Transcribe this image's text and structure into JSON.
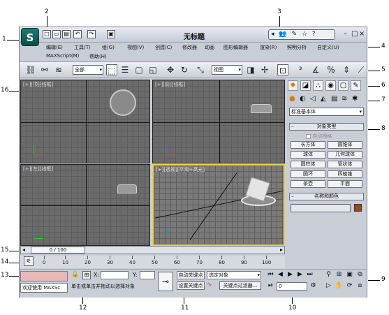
{
  "titlebar": {
    "app_logo": "S",
    "title": "无标题",
    "info_center": "◂ 👥 ✎ ☆ ?",
    "minimize": "–",
    "maximize": "□",
    "close": "×"
  },
  "quick_access": [
    "□",
    "▭",
    "▤",
    "↶",
    "↷",
    "▣"
  ],
  "menus": {
    "row1": [
      "编辑(E)",
      "工具(T)",
      "组(G)",
      "视图(V)",
      "创建(C)",
      "修改器",
      "动画",
      "图形编辑器",
      "渲染(R)",
      "照明分析",
      "自定义(U)"
    ],
    "row2": [
      "MAXScript(M)",
      "帮助(H)"
    ]
  },
  "toolbar": {
    "selection_filter": "全部",
    "ref_coord": "视图",
    "icons": [
      "link-icon",
      "unlink-icon",
      "bind-space-warp-icon",
      "select-object-icon",
      "select-by-name-icon",
      "rect-region-icon",
      "window-crossing-icon",
      "move-icon",
      "rotate-icon",
      "scale-icon",
      "pivot-icon",
      "manipulate-icon",
      "keyboard-shortcut-icon",
      "snap-3d-icon",
      "angle-snap-icon",
      "percent-snap-icon",
      "spinner-snap-icon",
      "named-selection-icon"
    ]
  },
  "viewports": [
    {
      "label": "[+][顶][线框]"
    },
    {
      "label": "[+][前][线框]"
    },
    {
      "label": "[+][左][线框]"
    },
    {
      "label": "[+][透视][平滑+高光]"
    }
  ],
  "command_panel": {
    "tabs": [
      "✹",
      "◪",
      "⛬",
      "◉",
      "▢",
      "✎"
    ],
    "sub_icons": [
      "●",
      "◐",
      "◁",
      "◭",
      "▤",
      "≋",
      "✱"
    ],
    "category": "标准基本体",
    "object_type_title": "对象类型",
    "autogrid": "自动栅格",
    "objects": [
      "长方体",
      "圆锥体",
      "球体",
      "几何球体",
      "圆柱体",
      "管状体",
      "圆环",
      "四棱锥",
      "茶壶",
      "平面"
    ],
    "name_color_title": "名称和颜色",
    "swatch_color": "#a0451c"
  },
  "timeline": {
    "frame": "0 / 100",
    "ticks": [
      "0",
      "10",
      "20",
      "30",
      "40",
      "50",
      "60",
      "70",
      "80",
      "90",
      "100"
    ]
  },
  "status": {
    "maxscript": "欢迎使用 MAXSc",
    "prompt": "单击或单击并拖动以选择对象",
    "x_label": "X:",
    "y_label": "Y:",
    "auto_key": "自动关键点",
    "set_key": "设置关键点",
    "selected": "选定对象",
    "key_filters": "关键点过滤器...",
    "current_frame": "0",
    "accent": "#e6b8b8"
  },
  "callouts": [
    "1",
    "2",
    "3",
    "4",
    "5",
    "6",
    "7",
    "8",
    "9",
    "10",
    "11",
    "12",
    "13",
    "14",
    "15",
    "16"
  ]
}
